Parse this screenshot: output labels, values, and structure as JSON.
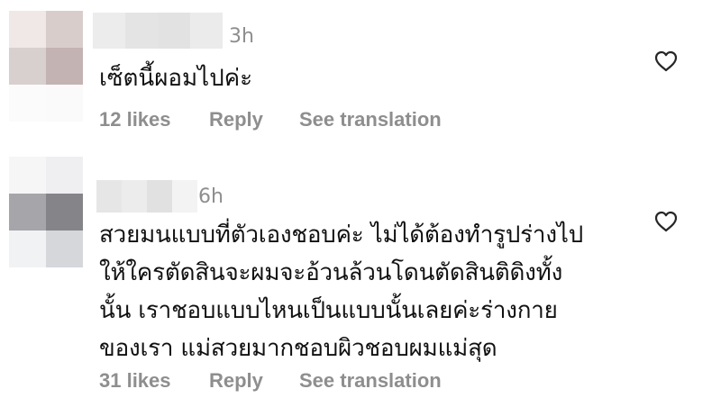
{
  "comments": [
    {
      "time": "3h",
      "text": "เซ็ตนี้ผอมไปค่ะ",
      "likes": "12 likes",
      "reply": "Reply",
      "translate": "See translation",
      "avatar_colors": [
        "#efe8e6",
        "#d9cdcb",
        "#d8d0cf",
        "#c4b3b3",
        "#fbfbfc",
        "#fafafb"
      ],
      "username_colors": [
        "#ececec",
        "#e4e4e4",
        "#e2e2e2",
        "#ebebeb"
      ]
    },
    {
      "time": "6h",
      "text": "สวยมนแบบที่ตัวเองชอบค่ะ ไม่ได้ต้องทำรูปร่างไป\nให้ใครตัดสินจะผมจะอ้วนล้วนโดนตัดสินติดิงทั้ง\nนั้น เราชอบแบบไหนเป็นแบบนั้นเลยค่ะร่างกาย\nของเรา แม่สวยมากชอบผิวชอบผมแม่สุด",
      "likes": "31 likes",
      "reply": "Reply",
      "translate": "See translation",
      "avatar_colors": [
        "#f6f6f7",
        "#efeff1",
        "#a5a5aa",
        "#858589",
        "#f1f2f4",
        "#d6d7db"
      ],
      "username_colors": [
        "#e6e6e6",
        "#ececec",
        "#e1e1e1",
        "#f3f3f3"
      ]
    }
  ]
}
